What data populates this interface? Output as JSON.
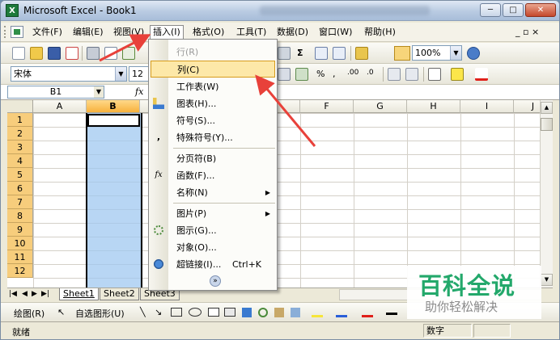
{
  "window": {
    "title": "Microsoft Excel - Book1",
    "app_icon": "X",
    "controls": [
      "─",
      "□",
      "✕"
    ]
  },
  "menubar": {
    "items": [
      "文件(F)",
      "编辑(E)",
      "视图(V)",
      "插入(I)",
      "格式(O)",
      "工具(T)",
      "数据(D)",
      "窗口(W)",
      "帮助(H)"
    ],
    "mdi_controls": "_ ▫ ×"
  },
  "toolbar": {
    "zoom": "100%",
    "font": "宋体",
    "font_size": "12",
    "sum_symbol": "Σ",
    "percent": "%",
    "comma": ",",
    "dec_inc": ".00",
    "dec_dec": ".0"
  },
  "formula": {
    "name_box": "B1",
    "fx": "fx"
  },
  "grid": {
    "columns": [
      "A",
      "B",
      "C",
      "D",
      "E",
      "F",
      "G",
      "H",
      "I",
      "J"
    ],
    "selected_column": "B",
    "rows": [
      "1",
      "2",
      "3",
      "4",
      "5",
      "6",
      "7",
      "8",
      "9",
      "10",
      "11",
      "12"
    ]
  },
  "insert_menu": [
    {
      "label": "行(R)",
      "disabled": true
    },
    {
      "label": "列(C)",
      "highlighted": true
    },
    {
      "label": "工作表(W)"
    },
    {
      "label": "图表(H)...",
      "icon": "chart-icon"
    },
    {
      "label": "符号(S)..."
    },
    {
      "label": "特殊符号(Y)...",
      "icon": "comma-icon"
    },
    {
      "label": "分页符(B)"
    },
    {
      "label": "函数(F)...",
      "icon": "fx-icon"
    },
    {
      "label": "名称(N)",
      "submenu": true
    },
    {
      "label": "图片(P)",
      "submenu": true
    },
    {
      "label": "图示(G)...",
      "icon": "diagram-icon"
    },
    {
      "label": "对象(O)..."
    },
    {
      "label": "超链接(I)...",
      "shortcut": "Ctrl+K",
      "icon": "hyperlink-icon"
    }
  ],
  "sheets": {
    "tabs": [
      "Sheet1",
      "Sheet2",
      "Sheet3"
    ],
    "active": "Sheet1"
  },
  "drawbar": {
    "draw": "绘图(R)",
    "autoshapes": "自选图形(U)"
  },
  "status": {
    "ready": "就绪",
    "num": "数字"
  },
  "watermark": {
    "line1": "百科全说",
    "line2": "助你轻松解决"
  },
  "colors": {
    "highlight": "#fde8a8",
    "selection": "#a0c8f0",
    "annotation": "#e8413a",
    "watermark": "#23a86b"
  }
}
